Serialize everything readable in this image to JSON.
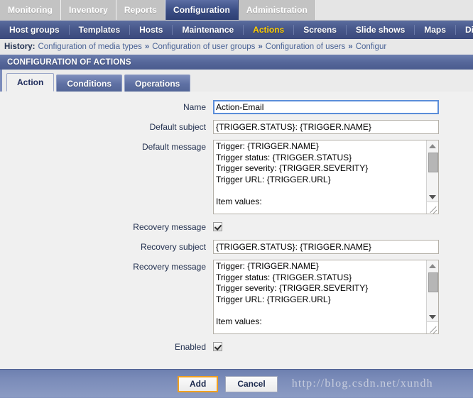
{
  "topnav": {
    "items": [
      {
        "label": "Monitoring",
        "active": false
      },
      {
        "label": "Inventory",
        "active": false
      },
      {
        "label": "Reports",
        "active": false
      },
      {
        "label": "Configuration",
        "active": true
      },
      {
        "label": "Administration",
        "active": false
      }
    ]
  },
  "subnav": {
    "items": [
      {
        "label": "Host groups",
        "current": false
      },
      {
        "label": "Templates",
        "current": false
      },
      {
        "label": "Hosts",
        "current": false
      },
      {
        "label": "Maintenance",
        "current": false
      },
      {
        "label": "Actions",
        "current": true
      },
      {
        "label": "Screens",
        "current": false
      },
      {
        "label": "Slide shows",
        "current": false
      },
      {
        "label": "Maps",
        "current": false
      },
      {
        "label": "Di",
        "current": false
      }
    ]
  },
  "history": {
    "label": "History:",
    "separator": "»",
    "crumbs": [
      "Configuration of media types",
      "Configuration of user groups",
      "Configuration of users",
      "Configur"
    ]
  },
  "page": {
    "title": "CONFIGURATION OF ACTIONS"
  },
  "tabs": [
    {
      "label": "Action",
      "selected": true
    },
    {
      "label": "Conditions",
      "selected": false
    },
    {
      "label": "Operations",
      "selected": false
    }
  ],
  "form": {
    "name": {
      "label": "Name",
      "value": "Action-Email",
      "focused": true
    },
    "default_subject": {
      "label": "Default subject",
      "value": "{TRIGGER.STATUS}: {TRIGGER.NAME}"
    },
    "default_message": {
      "label": "Default message",
      "value": "Trigger: {TRIGGER.NAME}\nTrigger status: {TRIGGER.STATUS}\nTrigger severity: {TRIGGER.SEVERITY}\nTrigger URL: {TRIGGER.URL}\n\nItem values:\n"
    },
    "recovery_message_toggle": {
      "label": "Recovery message",
      "checked": true
    },
    "recovery_subject": {
      "label": "Recovery subject",
      "value": "{TRIGGER.STATUS}: {TRIGGER.NAME}"
    },
    "recovery_message": {
      "label": "Recovery message",
      "value": "Trigger: {TRIGGER.NAME}\nTrigger status: {TRIGGER.STATUS}\nTrigger severity: {TRIGGER.SEVERITY}\nTrigger URL: {TRIGGER.URL}\n\nItem values:\n"
    },
    "enabled": {
      "label": "Enabled",
      "checked": true
    }
  },
  "footer": {
    "add_label": "Add",
    "cancel_label": "Cancel",
    "watermark": "http://blog.csdn.net/xundh"
  },
  "colors": {
    "accent_blue": "#3c4f86",
    "nav_current": "#ffcc00",
    "focus_border": "#5b8dd9",
    "primary_button_border": "#f0a020"
  }
}
